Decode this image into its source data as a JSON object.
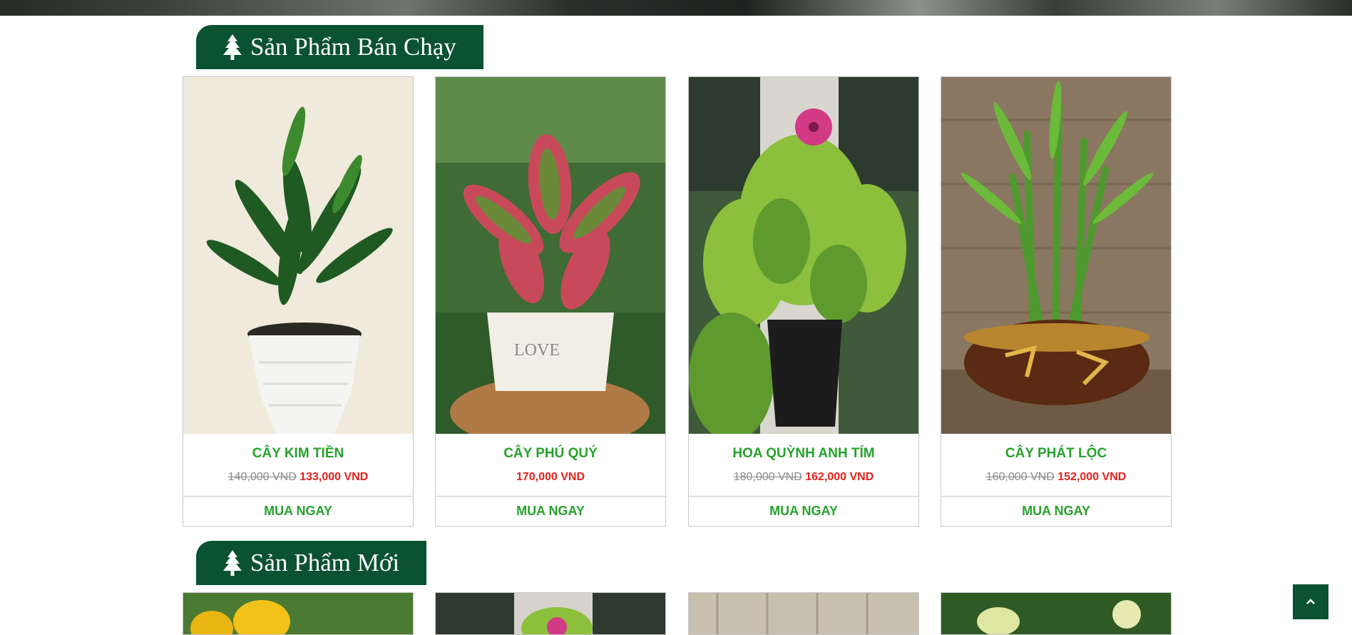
{
  "sections": [
    {
      "title": "Sản Phẩm Bán Chạy",
      "icon": "pine-tree-icon"
    },
    {
      "title": "Sản Phẩm Mới",
      "icon": "pine-tree-icon"
    }
  ],
  "best_sellers": [
    {
      "name": "CÂY KIM TIỀN",
      "old_price": "140,000 VND",
      "price": "133,000 VND",
      "buy_label": "MUA NGAY"
    },
    {
      "name": "CÂY PHÚ QUÝ",
      "old_price": "",
      "price": "170,000 VND",
      "buy_label": "MUA NGAY"
    },
    {
      "name": "HOA QUỲNH ANH TÍM",
      "old_price": "180,000 VND",
      "price": "162,000 VND",
      "buy_label": "MUA NGAY"
    },
    {
      "name": "CÂY PHÁT LỘC",
      "old_price": "160,000 VND",
      "price": "152,000 VND",
      "buy_label": "MUA NGAY"
    }
  ],
  "colors": {
    "brand_green": "#0b5231",
    "title_green": "#27a22c",
    "sale_red": "#e8211b"
  },
  "back_to_top": {
    "icon": "chevron-up-icon"
  }
}
